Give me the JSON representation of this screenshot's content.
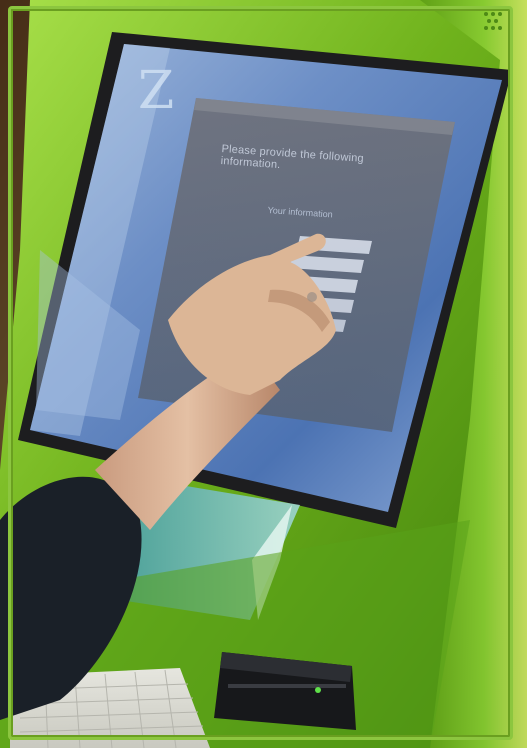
{
  "scene": {
    "kiosk_color": "#7fb51f",
    "screen_color": "#6f8fc3",
    "accent_frame": "#8cc63f"
  },
  "screen": {
    "logo_letter": "Z",
    "prompt": "Please provide the following information.",
    "section_label": "Your information"
  },
  "icons": [
    "speaker-grille-icon",
    "card-reader-icon",
    "status-led-icon"
  ]
}
